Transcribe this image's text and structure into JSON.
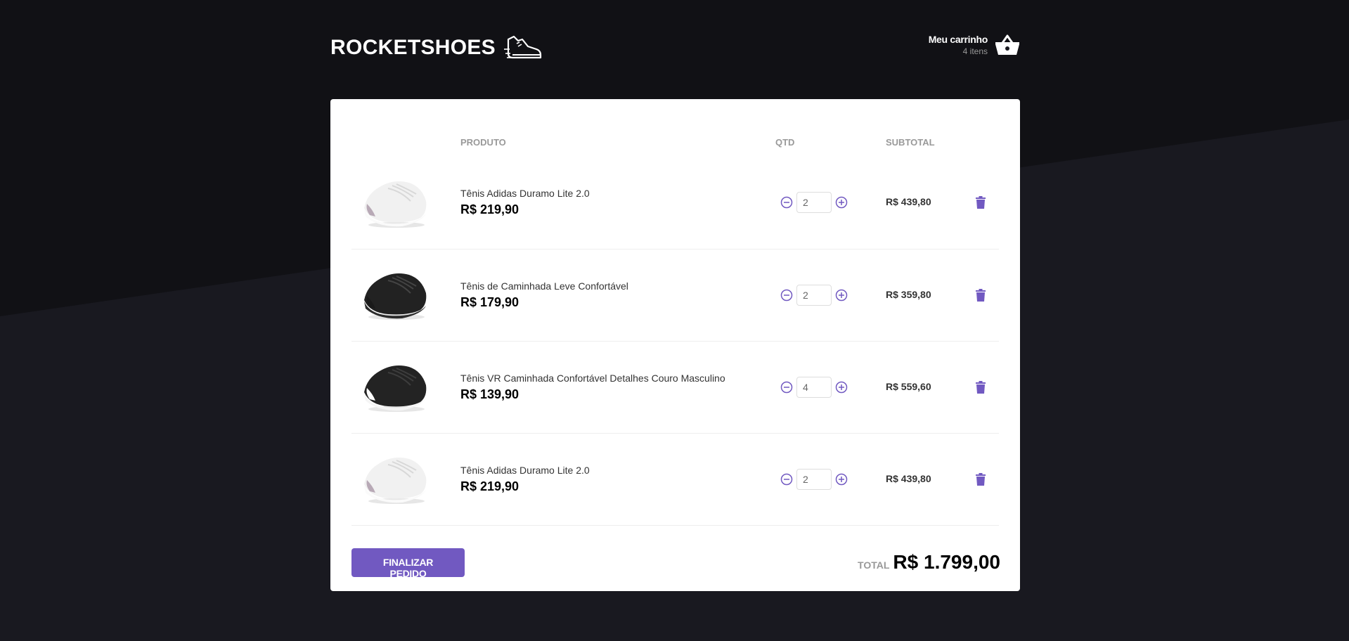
{
  "app": {
    "logo_text": "ROCKETSHOES"
  },
  "cart": {
    "title": "Meu carrinho",
    "count": "4 itens"
  },
  "table": {
    "headers": {
      "product": "PRODUTO",
      "qty": "QTD",
      "subtotal": "SUBTOTAL"
    },
    "rows": [
      {
        "title": "Tênis Adidas Duramo Lite 2.0",
        "price": "R$ 219,90",
        "qty": "2",
        "subtotal": "R$ 439,80",
        "shoe_color": "white"
      },
      {
        "title": "Tênis de Caminhada Leve Confortável",
        "price": "R$ 179,90",
        "qty": "2",
        "subtotal": "R$ 359,80",
        "shoe_color": "black"
      },
      {
        "title": "Tênis VR Caminhada Confortável Detalhes Couro Masculino",
        "price": "R$ 139,90",
        "qty": "4",
        "subtotal": "R$ 559,60",
        "shoe_color": "black-white"
      },
      {
        "title": "Tênis Adidas Duramo Lite 2.0",
        "price": "R$ 219,90",
        "qty": "2",
        "subtotal": "R$ 439,80",
        "shoe_color": "white"
      }
    ]
  },
  "footer": {
    "checkout_label": "Finalizar pedido",
    "total_label": "TOTAL",
    "total_value": "R$ 1.799,00"
  },
  "colors": {
    "accent": "#7159c1",
    "background": "#191920",
    "background_shape": "#111115"
  },
  "icons": [
    "sneaker-logo-icon",
    "basket-icon",
    "minus-circle-icon",
    "plus-circle-icon",
    "trash-icon"
  ]
}
